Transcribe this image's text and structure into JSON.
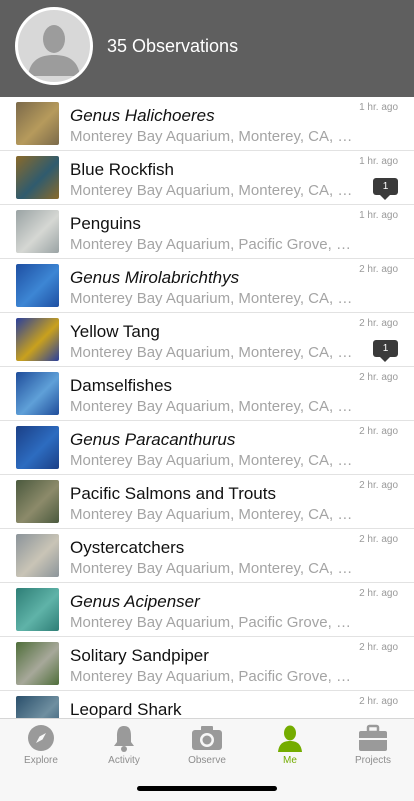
{
  "header": {
    "observation_count": "35 Observations",
    "avatar_icon": "person-silhouette-icon"
  },
  "observations": [
    {
      "name": "Genus Halichoeres",
      "italic": true,
      "place": "Monterey Bay Aquarium, Monterey, CA, US",
      "time": "1 hr. ago",
      "comments": "",
      "thumb_colors": [
        "#7b6a4a",
        "#b69a5c"
      ]
    },
    {
      "name": "Blue Rockfish",
      "italic": false,
      "place": "Monterey Bay Aquarium, Monterey, CA, US",
      "time": "1 hr. ago",
      "comments": "1",
      "thumb_colors": [
        "#8a6a2a",
        "#2f5b6e"
      ]
    },
    {
      "name": "Penguins",
      "italic": false,
      "place": "Monterey Bay Aquarium, Pacific Grove, C...",
      "time": "1 hr. ago",
      "comments": "",
      "thumb_colors": [
        "#9aa3a4",
        "#d5d7d3"
      ]
    },
    {
      "name": "Genus Mirolabrichthys",
      "italic": true,
      "place": "Monterey Bay Aquarium, Monterey, CA, US",
      "time": "2 hr. ago",
      "comments": "",
      "thumb_colors": [
        "#1e4fa2",
        "#3d86d4"
      ]
    },
    {
      "name": "Yellow Tang",
      "italic": false,
      "place": "Monterey Bay Aquarium, Monterey, CA, US",
      "time": "2 hr. ago",
      "comments": "1",
      "thumb_colors": [
        "#2a3f9c",
        "#c9a11d"
      ]
    },
    {
      "name": "Damselfishes",
      "italic": false,
      "place": "Monterey Bay Aquarium, Monterey, CA, US",
      "time": "2 hr. ago",
      "comments": "",
      "thumb_colors": [
        "#1f4d9a",
        "#5fa0d8"
      ]
    },
    {
      "name": "Genus Paracanthurus",
      "italic": true,
      "place": "Monterey Bay Aquarium, Monterey, CA, US",
      "time": "2 hr. ago",
      "comments": "",
      "thumb_colors": [
        "#1b3f86",
        "#2d6cc0"
      ]
    },
    {
      "name": "Pacific Salmons and Trouts",
      "italic": false,
      "place": "Monterey Bay Aquarium, Monterey, CA, US",
      "time": "2 hr. ago",
      "comments": "",
      "thumb_colors": [
        "#4b5a3e",
        "#8c8a6a"
      ]
    },
    {
      "name": "Oystercatchers",
      "italic": false,
      "place": "Monterey Bay Aquarium, Monterey, CA, US",
      "time": "2 hr. ago",
      "comments": "",
      "thumb_colors": [
        "#8b949a",
        "#c9c4b6"
      ]
    },
    {
      "name": "Genus Acipenser",
      "italic": true,
      "place": "Monterey Bay Aquarium, Pacific Grove, C...",
      "time": "2 hr. ago",
      "comments": "",
      "thumb_colors": [
        "#2e7e76",
        "#5fb3a8"
      ]
    },
    {
      "name": "Solitary Sandpiper",
      "italic": false,
      "place": "Monterey Bay Aquarium, Pacific Grove, C...",
      "time": "2 hr. ago",
      "comments": "",
      "thumb_colors": [
        "#4f6e3a",
        "#a7a89a"
      ]
    },
    {
      "name": "Leopard Shark",
      "italic": false,
      "place": "Monterey Bay Aquarium, Monterey, CA, US",
      "time": "2 hr. ago",
      "comments": "",
      "thumb_colors": [
        "#2a4f6b",
        "#6f8fa0"
      ]
    }
  ],
  "tabs": [
    {
      "label": "Explore",
      "icon": "compass-icon",
      "active": false
    },
    {
      "label": "Activity",
      "icon": "bell-icon",
      "active": false
    },
    {
      "label": "Observe",
      "icon": "camera-icon",
      "active": false
    },
    {
      "label": "Me",
      "icon": "person-icon",
      "active": true
    },
    {
      "label": "Projects",
      "icon": "briefcase-icon",
      "active": false
    }
  ],
  "colors": {
    "header_bg": "#5f5f5f",
    "accent": "#74ac00",
    "tab_inactive": "#8e8e8e",
    "text_secondary": "#a4a4a4"
  }
}
